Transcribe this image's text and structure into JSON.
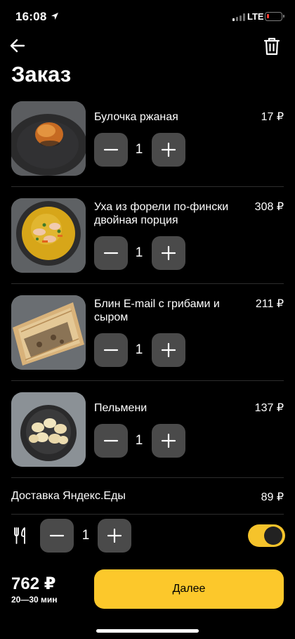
{
  "status_bar": {
    "time": "16:08",
    "network": "LTE"
  },
  "header": {
    "title": "Заказ"
  },
  "items": [
    {
      "name": "Булочка ржаная",
      "price": "17 ₽",
      "quantity": "1",
      "photo": "bun"
    },
    {
      "name": "Уха из форели по-фински двойная порция",
      "price": "308 ₽",
      "quantity": "1",
      "photo": "soup"
    },
    {
      "name": "Блин E-mail с грибами и сыром",
      "price": "211 ₽",
      "quantity": "1",
      "photo": "crepe"
    },
    {
      "name": "Пельмени",
      "price": "137 ₽",
      "quantity": "1",
      "photo": "dumplings"
    }
  ],
  "delivery": {
    "label": "Доставка Яндекс.Еды",
    "price": "89 ₽"
  },
  "cutlery": {
    "quantity": "1",
    "toggle_on": true
  },
  "footer": {
    "total": "762 ₽",
    "eta": "20—30 мин",
    "next_label": "Далее"
  },
  "colors": {
    "accent": "#fcc82b",
    "button_bg": "#4a4a4a",
    "background": "#000000",
    "battery_low": "#ff3b30"
  },
  "icons": {
    "back": "arrow-left-icon",
    "trash": "trash-icon",
    "minus": "minus-icon",
    "plus": "plus-icon",
    "cutlery": "cutlery-icon"
  }
}
